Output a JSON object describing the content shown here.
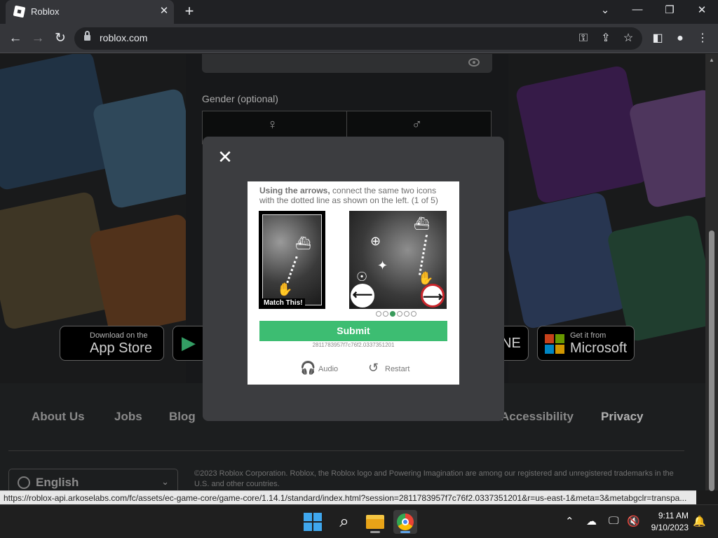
{
  "browser": {
    "tab_title": "Roblox",
    "url": "roblox.com",
    "status_url": "https://roblox-api.arkoselabs.com/fc/assets/ec-game-core/game-core/1.14.1/standard/index.html?session=2811783957f7c76f2.0337351201&r=us-east-1&meta=3&metabgclr=transpa..."
  },
  "signup": {
    "gender_label": "Gender (optional)"
  },
  "badges": {
    "appstore_small": "Download on the",
    "appstore_big": "App Store",
    "microsoft_small": "Get it from",
    "microsoft_big": "Microsoft",
    "xbox_partial": "NE"
  },
  "footer": {
    "links": [
      "About Us",
      "Jobs",
      "Blog",
      "Accessibility",
      "Privacy"
    ],
    "language": "English",
    "copyright": "©2023 Roblox Corporation. Roblox, the Roblox logo and Powering Imagination are among our registered and unregistered trademarks in the U.S. and other countries."
  },
  "captcha": {
    "instruction_bold": "Using the arrows,",
    "instruction_rest": " connect the same two icons with the dotted line as shown on the left. (1 of 5)",
    "match_label": "Match This!",
    "submit_label": "Submit",
    "session_id": "2811783957f7c76f2.0337351201",
    "audio_label": "Audio",
    "restart_label": "Restart",
    "progress": {
      "current": 3,
      "total": 6
    }
  },
  "taskbar": {
    "time": "9:11 AM",
    "date": "9/10/2023"
  },
  "colors": {
    "submit": "#3dbd72",
    "chrome_dark": "#202124",
    "windows_blue": "#3fa7ee"
  }
}
